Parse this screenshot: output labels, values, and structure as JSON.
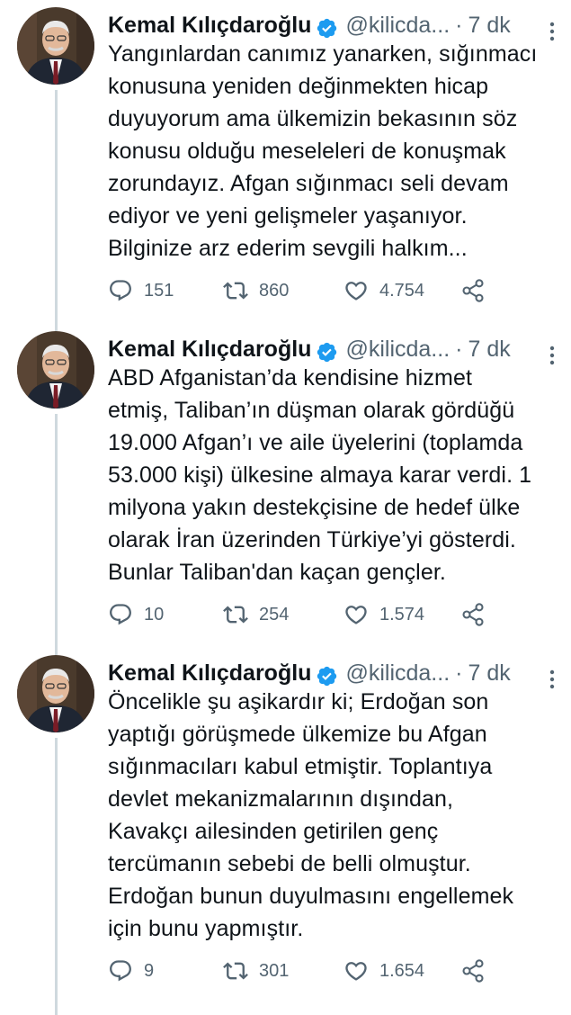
{
  "tweets": [
    {
      "author_name": "Kemal Kılıçdaroğlu",
      "handle": "@kilicda...",
      "separator": "·",
      "time": "7 dk",
      "text_lines": [
        "Yangınlardan canımız yanarken, sığınmacı",
        "konusuna yeniden değinmekten hicap",
        "duyuyorum ama ülkemizin bekasının söz",
        "konusu olduğu meseleleri de konuşmak",
        "zorundayız. Afgan sığınmacı seli devam",
        "ediyor ve yeni gelişmeler yaşanıyor.",
        "Bilginize arz ederim sevgili halkım..."
      ],
      "replies": "151",
      "retweets": "860",
      "likes": "4.754"
    },
    {
      "author_name": "Kemal Kılıçdaroğlu",
      "handle": "@kilicda...",
      "separator": "·",
      "time": "7 dk",
      "text_lines": [
        "ABD Afganistan’da kendisine hizmet",
        "etmiş, Taliban’ın düşman olarak gördüğü",
        "19.000 Afgan’ı ve aile üyelerini (toplamda",
        "53.000 kişi) ülkesine almaya karar verdi. 1",
        "milyona yakın destekçisine de hedef ülke",
        "olarak İran üzerinden Türkiye’yi gösterdi.",
        "Bunlar Taliban'dan kaçan gençler."
      ],
      "replies": "10",
      "retweets": "254",
      "likes": "1.574"
    },
    {
      "author_name": "Kemal Kılıçdaroğlu",
      "handle": "@kilicda...",
      "separator": "·",
      "time": "7 dk",
      "text_lines": [
        "Öncelikle şu aşikardır ki; Erdoğan son",
        "yaptığı görüşmede ülkemize bu Afgan",
        "sığınmacıları kabul etmiştir. Toplantıya",
        "devlet mekanizmalarının dışından,",
        "Kavakçı ailesinden getirilen genç",
        "tercümanın sebebi de belli olmuştur.",
        "Erdoğan bunun duyulmasını engellemek",
        "için bunu yapmıştır."
      ],
      "replies": "9",
      "retweets": "301",
      "likes": "1.654"
    }
  ],
  "icons": {
    "verified": "verified-badge-icon",
    "more": "more-vertical-icon",
    "reply": "reply-icon",
    "retweet": "retweet-icon",
    "like": "like-icon",
    "share": "share-icon"
  },
  "colors": {
    "text": "#0f1419",
    "secondary": "#536471",
    "verified": "#1d9bf0",
    "thread_line": "#cfd9de"
  }
}
